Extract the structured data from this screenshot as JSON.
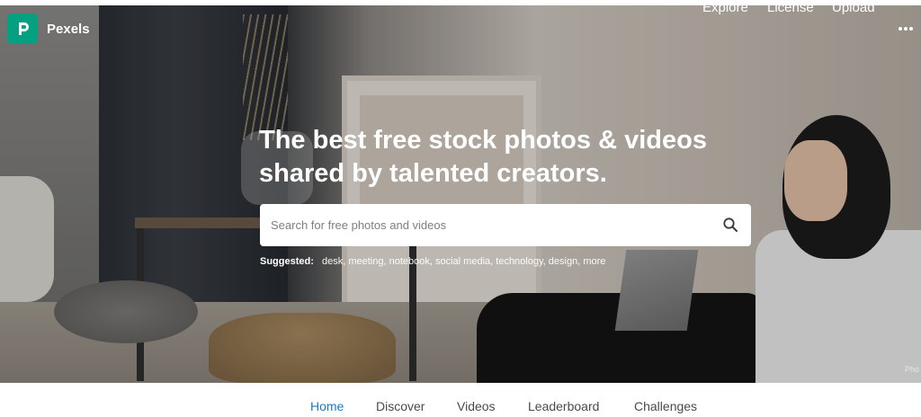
{
  "header": {
    "brand": "Pexels",
    "nav": [
      {
        "label": "Explore"
      },
      {
        "label": "License"
      },
      {
        "label": "Upload"
      }
    ],
    "more_icon": "ellipsis-icon",
    "logo_icon": "pexels-logo-icon"
  },
  "hero": {
    "headline_line1": "The best free stock photos & videos",
    "headline_line2": "shared by talented creators.",
    "search": {
      "placeholder": "Search for free photos and videos",
      "value": "",
      "icon": "search-icon"
    },
    "suggested": {
      "label": "Suggested:",
      "tags": [
        "desk",
        "meeting",
        "notebook",
        "social media",
        "technology",
        "design",
        "more"
      ]
    },
    "photo_credit": "Pho"
  },
  "tabs": [
    {
      "label": "Home",
      "active": true
    },
    {
      "label": "Discover",
      "active": false
    },
    {
      "label": "Videos",
      "active": false
    },
    {
      "label": "Leaderboard",
      "active": false
    },
    {
      "label": "Challenges",
      "active": false
    }
  ],
  "colors": {
    "brand": "#05a081",
    "active_tab": "#1c7bc8",
    "tab_text": "#4a4a4a"
  }
}
